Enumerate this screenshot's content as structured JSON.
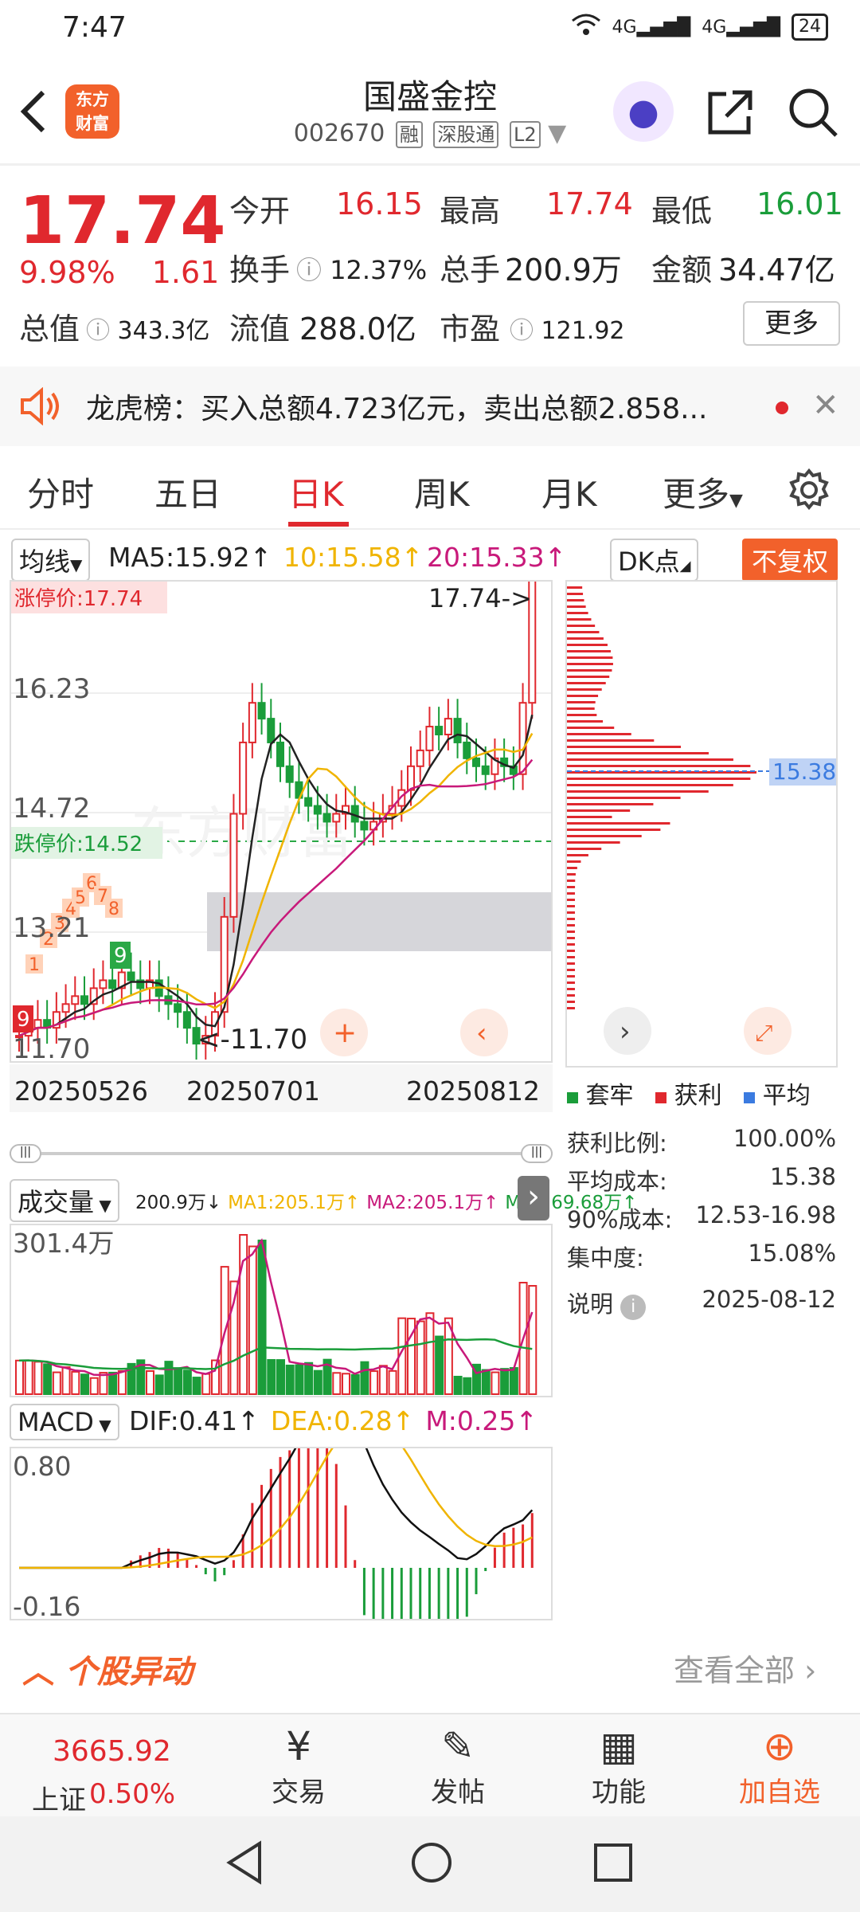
{
  "status": {
    "time": "7:47",
    "net1": "4G",
    "net2": "4G",
    "battery": "24"
  },
  "header": {
    "logo": "东方财富",
    "title": "国盛金控",
    "code": "002670",
    "tags": [
      "融",
      "深股通",
      "L2"
    ]
  },
  "quote": {
    "price": "17.74",
    "pct": "9.98%",
    "chg": "1.61",
    "open_l": "今开",
    "open": "16.15",
    "high_l": "最高",
    "high": "17.74",
    "low_l": "最低",
    "low": "16.01",
    "turn_l": "换手",
    "turn": "12.37%",
    "vol_l": "总手",
    "vol": "200.9万",
    "amt_l": "金额",
    "amt": "34.47亿",
    "mcap_l": "总值",
    "mcap": "343.3亿",
    "float_l": "流值",
    "float": "288.0亿",
    "pe_l": "市盈",
    "pe": "121.92",
    "more": "更多"
  },
  "notice": {
    "text": "龙虎榜：买入总额4.723亿元，卖出总额2.858..."
  },
  "tabs": [
    "分时",
    "五日",
    "日K",
    "周K",
    "月K",
    "更多"
  ],
  "chart": {
    "ma_sel": "均线",
    "ma5": "MA5:15.92↑",
    "ma10": "10:15.58↑",
    "ma20": "20:15.33↑",
    "dk": "DK点",
    "fq": "不复权",
    "zt": "涨停价:17.74",
    "dt": "跌停价:14.52",
    "last": "17.74->",
    "low": "<-11.70",
    "y1": "16.23",
    "y2": "14.72",
    "y3": "13.21",
    "y4": "11.70",
    "dates": [
      "20250526",
      "20250701",
      "20250812"
    ],
    "avg": "15.38",
    "watermark": "东方财富",
    "nums": [
      "1",
      "2",
      "3",
      "4",
      "5",
      "6",
      "7",
      "8",
      "9",
      "9",
      "9"
    ]
  },
  "chips": {
    "legend": [
      "套牢",
      "获利",
      "平均"
    ],
    "rows": [
      [
        "获利比例:",
        "100.00%"
      ],
      [
        "平均成本:",
        "15.38"
      ],
      [
        "90%成本:",
        "12.53-16.98"
      ],
      [
        "集中度:",
        "15.08%"
      ]
    ],
    "note": "说明",
    "date": "2025-08-12"
  },
  "volume": {
    "sel": "成交量",
    "v": "200.9万↓",
    "ma1": "MA1:205.1万↑",
    "ma2": "MA2:205.1万↑",
    "ma3": "MA3:69.68万↑",
    "max": "301.4万"
  },
  "macd": {
    "sel": "MACD",
    "dif": "DIF:0.41↑",
    "dea": "DEA:0.28↑",
    "m": "M:0.25↑",
    "top": "0.80",
    "bot": "-0.16"
  },
  "abnormal": {
    "title": "个股异动",
    "all": "查看全部"
  },
  "bottom": {
    "index_val": "3665.92",
    "index_name": "上证",
    "index_pct": "0.50%",
    "items": [
      "交易",
      "发帖",
      "功能",
      "加自选"
    ]
  },
  "colors": {
    "up": "#e0282e",
    "down": "#1a9d3a",
    "accent": "#f2612b",
    "ma10": "#f0b400",
    "ma20": "#c8197a",
    "avg": "#3b7be0"
  }
}
